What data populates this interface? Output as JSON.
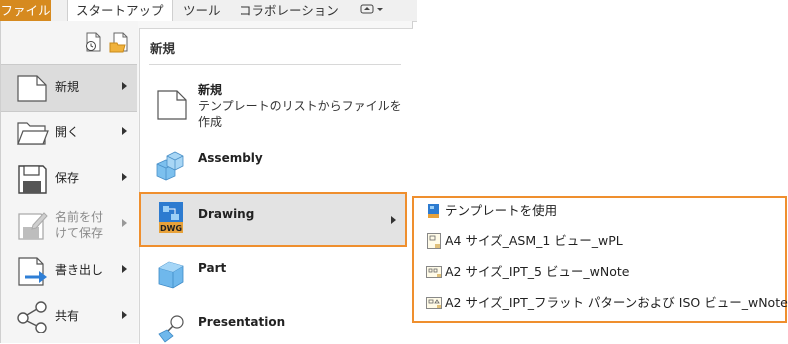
{
  "ribbon": {
    "tabs": [
      "ファイル",
      "スタートアップ",
      "ツール",
      "コラボレーション"
    ],
    "active_tab": "ファイル"
  },
  "left_menu": {
    "items": [
      {
        "label": "新規",
        "arrow": true,
        "active": true,
        "enabled": true,
        "icon": "new-document-icon"
      },
      {
        "label": "開く",
        "arrow": true,
        "active": false,
        "enabled": true,
        "icon": "open-folder-icon"
      },
      {
        "label": "保存",
        "arrow": true,
        "active": false,
        "enabled": true,
        "icon": "save-disk-icon"
      },
      {
        "label": "名前を付\nけて保存",
        "arrow": true,
        "active": false,
        "enabled": false,
        "icon": "save-as-icon"
      },
      {
        "label": "書き出し",
        "arrow": true,
        "active": false,
        "enabled": true,
        "icon": "export-icon"
      },
      {
        "label": "共有",
        "arrow": true,
        "active": false,
        "enabled": true,
        "icon": "share-icon"
      }
    ]
  },
  "new_panel": {
    "title": "新規",
    "items": [
      {
        "name": "新規",
        "description": "テンプレートのリストからファイルを作成",
        "icon": "new-document-icon"
      },
      {
        "name": "Assembly",
        "icon": "assembly-icon"
      },
      {
        "name": "Drawing",
        "icon": "drawing-dwg-icon",
        "arrow": true,
        "selected": true
      },
      {
        "name": "Part",
        "icon": "part-cube-icon"
      },
      {
        "name": "Presentation",
        "icon": "presentation-icon"
      }
    ]
  },
  "drawing_submenu": {
    "items": [
      {
        "label": "テンプレートを使用",
        "icon": "template-icon"
      },
      {
        "label": "A4 サイズ_ASM_1 ビュー_wPL",
        "icon": "drawing-template-icon"
      },
      {
        "label": "A2 サイズ_IPT_5 ビュー_wNote",
        "icon": "drawing-template-icon"
      },
      {
        "label": "A2 サイズ_IPT_フラット パターンおよび ISO ビュー_wNote",
        "icon": "drawing-template-icon"
      }
    ]
  },
  "colors": {
    "accent_orange": "#ef8f2e",
    "file_tab": "#d68a1f",
    "selected_bg": "#e3e3e3"
  }
}
